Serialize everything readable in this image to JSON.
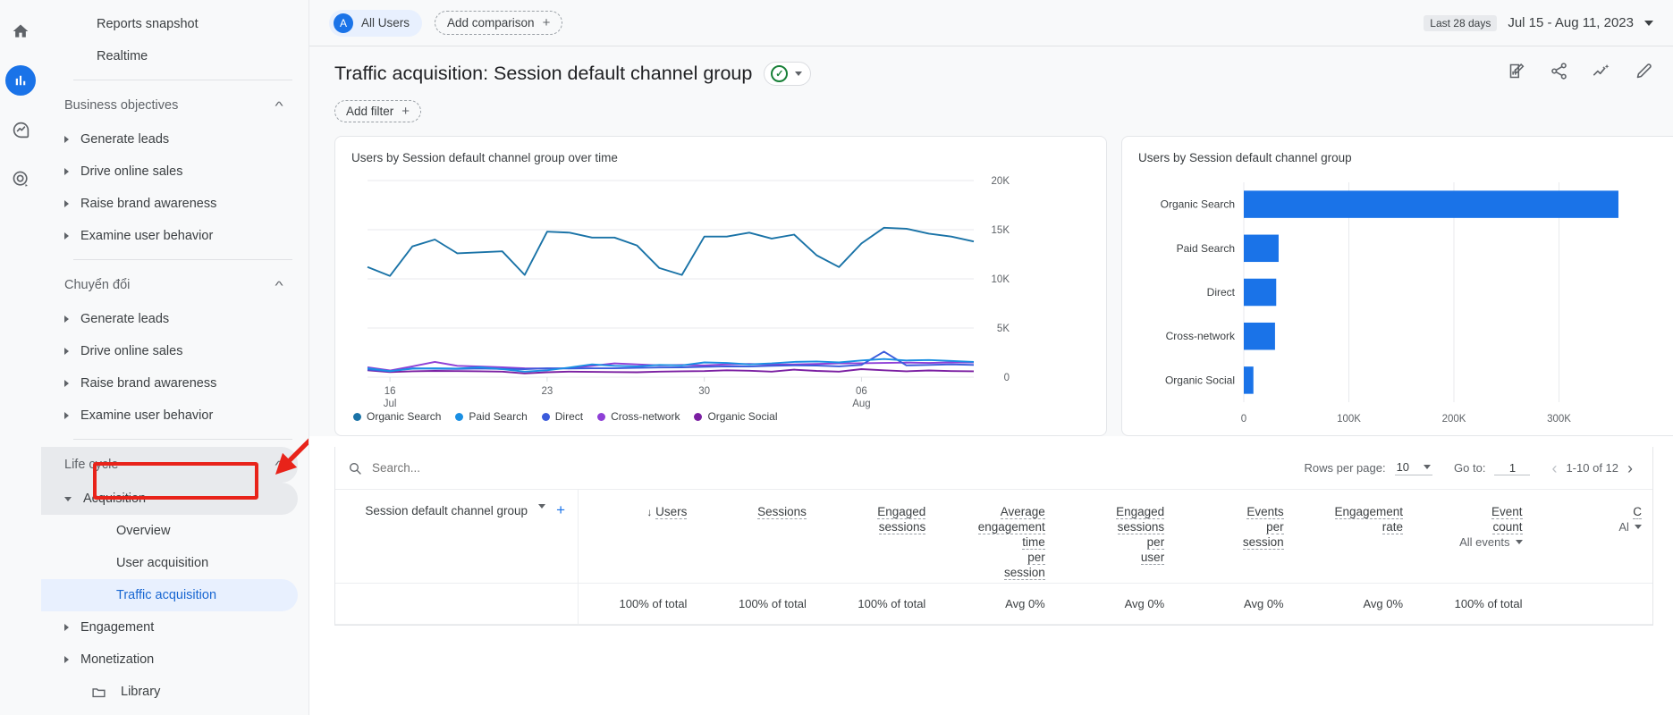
{
  "rail": {
    "items": [
      {
        "name": "home-icon",
        "label": "Home"
      },
      {
        "name": "reports-icon",
        "label": "Reports"
      },
      {
        "name": "explore-icon",
        "label": "Explore"
      },
      {
        "name": "advertising-icon",
        "label": "Advertising"
      }
    ]
  },
  "sidebar": {
    "top": [
      {
        "label": "Reports snapshot"
      },
      {
        "label": "Realtime"
      }
    ],
    "sections": [
      {
        "title": "Business objectives",
        "items": [
          {
            "label": "Generate leads"
          },
          {
            "label": "Drive online sales"
          },
          {
            "label": "Raise brand awareness"
          },
          {
            "label": "Examine user behavior"
          }
        ]
      },
      {
        "title": "Chuyển đổi",
        "items": [
          {
            "label": "Generate leads"
          },
          {
            "label": "Drive online sales"
          },
          {
            "label": "Raise brand awareness"
          },
          {
            "label": "Examine user behavior"
          }
        ]
      }
    ],
    "lifecycle": {
      "title": "Life cycle",
      "acquisition": "Acquisition",
      "children": [
        {
          "label": "Overview"
        },
        {
          "label": "User acquisition"
        },
        {
          "label": "Traffic acquisition"
        }
      ],
      "more": [
        {
          "label": "Engagement"
        },
        {
          "label": "Monetization"
        }
      ]
    },
    "library": "Library",
    "selected": "Traffic acquisition",
    "annotation_color": "#e8231a"
  },
  "topbar": {
    "segment": "All Users",
    "segment_initial": "A",
    "add_comparison": "Add comparison",
    "last_days_badge": "Last 28 days",
    "date_range": "Jul 15 - Aug 11, 2023"
  },
  "title": {
    "text": "Traffic acquisition: Session default channel group",
    "add_filter": "Add filter",
    "icons": [
      {
        "name": "customize-report-icon"
      },
      {
        "name": "share-icon"
      },
      {
        "name": "insights-icon"
      },
      {
        "name": "edit-icon"
      }
    ]
  },
  "line_card": {
    "title": "Users by Session default channel group over time"
  },
  "bar_card": {
    "title": "Users by Session default channel group"
  },
  "table": {
    "search_placeholder": "Search...",
    "dimension": "Session default channel group",
    "rows_per_page_label": "Rows per page:",
    "rows_per_page_value": "10",
    "goto_label": "Go to:",
    "goto_value": "1",
    "range": "1-10 of 12",
    "columns": [
      {
        "label": "Users",
        "sorted": true,
        "summary": "100% of total"
      },
      {
        "label": "Sessions",
        "summary": "100% of total"
      },
      {
        "label": "Engaged sessions",
        "summary": "100% of total"
      },
      {
        "label": "Average engagement time per session",
        "summary": "Avg 0%"
      },
      {
        "label": "Engaged sessions per user",
        "summary": "Avg 0%"
      },
      {
        "label": "Events per session",
        "summary": "Avg 0%"
      },
      {
        "label": "Engagement rate",
        "summary": "Avg 0%"
      },
      {
        "label": "Event count",
        "sub": "All events",
        "summary": "100% of total"
      },
      {
        "label": "C",
        "sub": "Al",
        "summary": ""
      }
    ]
  },
  "chart_data": [
    {
      "type": "line",
      "title": "Users by Session default channel group over time",
      "xlabel": "",
      "ylabel": "Users",
      "ylim": [
        0,
        20000
      ],
      "yticks": [
        "0",
        "5K",
        "10K",
        "15K",
        "20K"
      ],
      "xticks": [
        {
          "day": "16",
          "month": "Jul"
        },
        {
          "day": "23",
          "month": ""
        },
        {
          "day": "30",
          "month": ""
        },
        {
          "day": "06",
          "month": "Aug"
        }
      ],
      "grid": true,
      "legend_position": "bottom-left",
      "series": [
        {
          "name": "Organic Search",
          "color": "#1a73a7",
          "values": [
            11200,
            10300,
            13300,
            14000,
            12600,
            12700,
            12800,
            10400,
            14800,
            14700,
            14200,
            14200,
            13400,
            11100,
            10400,
            14300,
            14300,
            14700,
            14100,
            14500,
            12400,
            11200,
            13600,
            15200,
            15100,
            14600,
            14300,
            13800
          ]
        },
        {
          "name": "Paid Search",
          "color": "#1a8fe3",
          "values": [
            900,
            620,
            860,
            900,
            880,
            1000,
            820,
            560,
            700,
            980,
            1300,
            1150,
            1100,
            1250,
            1200,
            1500,
            1450,
            1300,
            1400,
            1550,
            1600,
            1500,
            1700,
            1850,
            1700,
            1750,
            1650,
            1550
          ]
        },
        {
          "name": "Direct",
          "color": "#3b5bdb",
          "values": [
            760,
            600,
            900,
            860,
            840,
            880,
            840,
            820,
            900,
            880,
            900,
            900,
            950,
            980,
            1000,
            1050,
            1100,
            1080,
            1150,
            1200,
            1180,
            1100,
            1250,
            2600,
            1200,
            1250,
            1300,
            1250
          ]
        },
        {
          "name": "Cross-network",
          "color": "#8e3fd6",
          "values": [
            1000,
            680,
            1100,
            1550,
            1150,
            1080,
            1000,
            900,
            880,
            900,
            1150,
            1400,
            1300,
            1200,
            1250,
            1200,
            1300,
            1350,
            1280,
            1300,
            1350,
            1400,
            1420,
            1450,
            1480,
            1450,
            1500,
            1500
          ]
        },
        {
          "name": "Organic Social",
          "color": "#7b1fa2",
          "values": [
            700,
            520,
            600,
            640,
            620,
            600,
            560,
            380,
            500,
            560,
            540,
            520,
            500,
            560,
            600,
            620,
            700,
            650,
            560,
            760,
            640,
            560,
            820,
            700,
            600,
            680,
            620,
            600
          ]
        }
      ]
    },
    {
      "type": "bar",
      "orientation": "horizontal",
      "title": "Users by Session default channel group",
      "categories": [
        "Organic Search",
        "Paid Search",
        "Direct",
        "Cross-network",
        "Organic Social"
      ],
      "values": [
        312000,
        29000,
        27000,
        26000,
        8000
      ],
      "xticks": [
        "0",
        "100K",
        "200K",
        "300K"
      ],
      "xlim": [
        0,
        350000
      ],
      "color": "#1a73e8",
      "grid": true
    }
  ]
}
